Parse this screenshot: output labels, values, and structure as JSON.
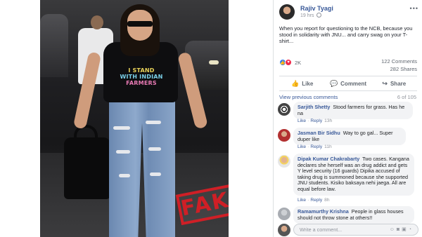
{
  "photo": {
    "tshirt_line1": "I STAND",
    "tshirt_line2": "WITH INDIAN",
    "tshirt_line3": "FARMERS",
    "stamp_text": "FAKE",
    "stamp_color": "#cf1f26"
  },
  "post": {
    "author": "Rajiv Tyagi",
    "time": "19 hrs",
    "privacy_icon": "globe-icon",
    "more_icon": "more-dots-icon",
    "text": "When you report for questioning to the NCB, because you stood in solidarity with JNU... and carry swag on your T-shirt..."
  },
  "stats": {
    "reactions_count": "2K",
    "reaction_icons": [
      "like-icon",
      "love-icon"
    ],
    "comments": "122 Comments",
    "shares": "282 Shares"
  },
  "actions": {
    "like": "Like",
    "comment": "Comment",
    "share": "Share"
  },
  "comments_meta": {
    "view_previous": "View previous comments",
    "count": "6 of 105"
  },
  "comments": [
    {
      "name": "Sarjith Shetty",
      "text": "Stood farmers for grass. Has he na",
      "like": "Like",
      "reply": "Reply",
      "time": "13h"
    },
    {
      "name": "Jasman Bir Sidhu",
      "text": "Way to go gal... Super duper like",
      "like": "Like",
      "reply": "Reply",
      "time": "11h"
    },
    {
      "name": "Dipak Kumar Chakrabarty",
      "text": "Two cases. Kangana declares she herself was an drug addict and gets Y level security (16 guards) Dipika accused of taking drug is summoned because she supported JNU students. Kisiko baksaya nehi jaega. All are equal before law.",
      "like": "Like",
      "reply": "Reply",
      "time": "8h"
    },
    {
      "name": "Ramamurthy Krishna",
      "text": "People in glass houses should not throw stone at others!!"
    }
  ],
  "write_comment": {
    "placeholder": "Write a comment...",
    "icons": [
      "emoji-icon",
      "camera-icon",
      "gif-icon",
      "sticker-icon"
    ]
  },
  "colors": {
    "link_blue": "#385898",
    "meta_gray": "#90949c",
    "bubble_bg": "#f2f3f5"
  }
}
